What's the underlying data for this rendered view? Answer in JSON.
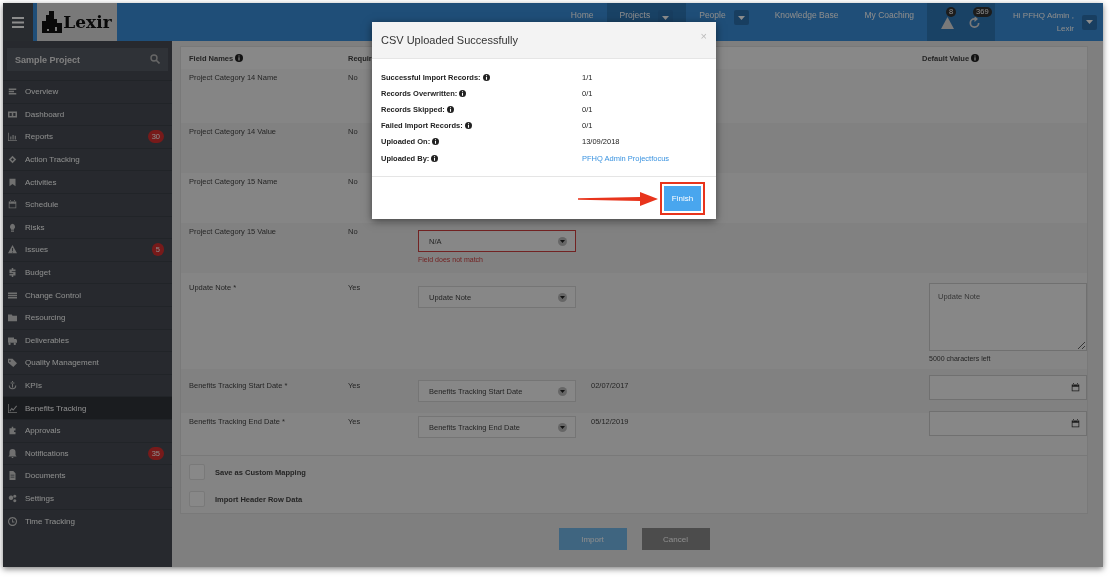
{
  "logo": "Lexir",
  "nav": [
    {
      "label": "Home",
      "selected": false,
      "caret": false
    },
    {
      "label": "Projects",
      "selected": true,
      "caret": true
    },
    {
      "label": "People",
      "selected": false,
      "caret": true
    },
    {
      "label": "Knowledge Base",
      "selected": false,
      "caret": false
    },
    {
      "label": "My Coaching",
      "selected": false,
      "caret": false
    }
  ],
  "alerts": [
    {
      "badge": "8"
    },
    {
      "badge": "369"
    }
  ],
  "user": {
    "greeting": "Hi PFHQ Admin ,",
    "name": "Lexir"
  },
  "sidebar": {
    "search": {
      "placeholder": "Sample Project"
    },
    "items": [
      {
        "label": "Overview",
        "selected": false
      },
      {
        "label": "Dashboard",
        "selected": false
      },
      {
        "label": "Reports",
        "selected": false,
        "badge": "30"
      },
      {
        "label": "Action Tracking",
        "selected": false
      },
      {
        "label": "Activities",
        "selected": false
      },
      {
        "label": "Schedule",
        "selected": false
      },
      {
        "label": "Risks",
        "selected": false
      },
      {
        "label": "Issues",
        "selected": false,
        "badge": "5"
      },
      {
        "label": "Budget",
        "selected": false
      },
      {
        "label": "Change Control",
        "selected": false
      },
      {
        "label": "Resourcing",
        "selected": false
      },
      {
        "label": "Deliverables",
        "selected": false
      },
      {
        "label": "Quality Management",
        "selected": false
      },
      {
        "label": "KPIs",
        "selected": false
      },
      {
        "label": "Benefits Tracking",
        "selected": true
      },
      {
        "label": "Approvals",
        "selected": false
      },
      {
        "label": "Notifications",
        "selected": false,
        "badge": "35"
      },
      {
        "label": "Documents",
        "selected": false
      },
      {
        "label": "Settings",
        "selected": false
      },
      {
        "label": "Time Tracking",
        "selected": false
      }
    ]
  },
  "table": {
    "columns": [
      {
        "label": "Field Names",
        "info": true
      },
      {
        "label": "Requir"
      },
      {
        "label": "Default Value",
        "info": true
      }
    ],
    "rows": [
      {
        "name": "Project Category 14 Name",
        "required": "No"
      },
      {
        "name": "Project Category 14 Value",
        "required": "No"
      },
      {
        "name": "Project Category 15 Name",
        "required": "No"
      },
      {
        "name": "Project Category 15 Value",
        "required": "No",
        "mapping": "N/A",
        "error": "Field does not match"
      },
      {
        "name": "Update Note *",
        "required": "Yes",
        "mapping": "Update Note",
        "default": {
          "kind": "textarea",
          "placeholder": "Update Note",
          "counter": "5000 characters left"
        }
      },
      {
        "name": "Benefits Tracking Start Date *",
        "required": "Yes",
        "mapping": "Benefits Tracking Start Date",
        "preview": "02/07/2017",
        "default": {
          "kind": "date"
        }
      },
      {
        "name": "Benefits Tracking End Date *",
        "required": "Yes",
        "mapping": "Benefits Tracking End Date",
        "preview": "05/12/2019",
        "default": {
          "kind": "date"
        }
      }
    ]
  },
  "options": [
    {
      "label": "Save as Custom Mapping",
      "checked": false
    },
    {
      "label": "Import Header Row Data",
      "checked": false
    }
  ],
  "buttons": [
    {
      "label": "Import",
      "kind": "primary",
      "disabled": true
    },
    {
      "label": "Cancel",
      "kind": "secondary",
      "disabled": false
    }
  ],
  "modal": {
    "title": "CSV Uploaded Successfully",
    "close": "×",
    "fields": [
      {
        "label": "Successful Import Records:",
        "value": "1/1",
        "kind": "text"
      },
      {
        "label": "Records Overwritten:",
        "value": "0/1",
        "kind": "text"
      },
      {
        "label": "Records Skipped:",
        "value": "0/1",
        "kind": "text"
      },
      {
        "label": "Failed Import Records:",
        "value": "0/1",
        "kind": "text"
      },
      {
        "label": "Uploaded On:",
        "value": "13/09/2018",
        "kind": "text"
      },
      {
        "label": "Uploaded By:",
        "value": "PFHQ Admin Projectfocus",
        "kind": "link"
      }
    ],
    "button": {
      "label": "Finish",
      "highlighted": true
    }
  }
}
